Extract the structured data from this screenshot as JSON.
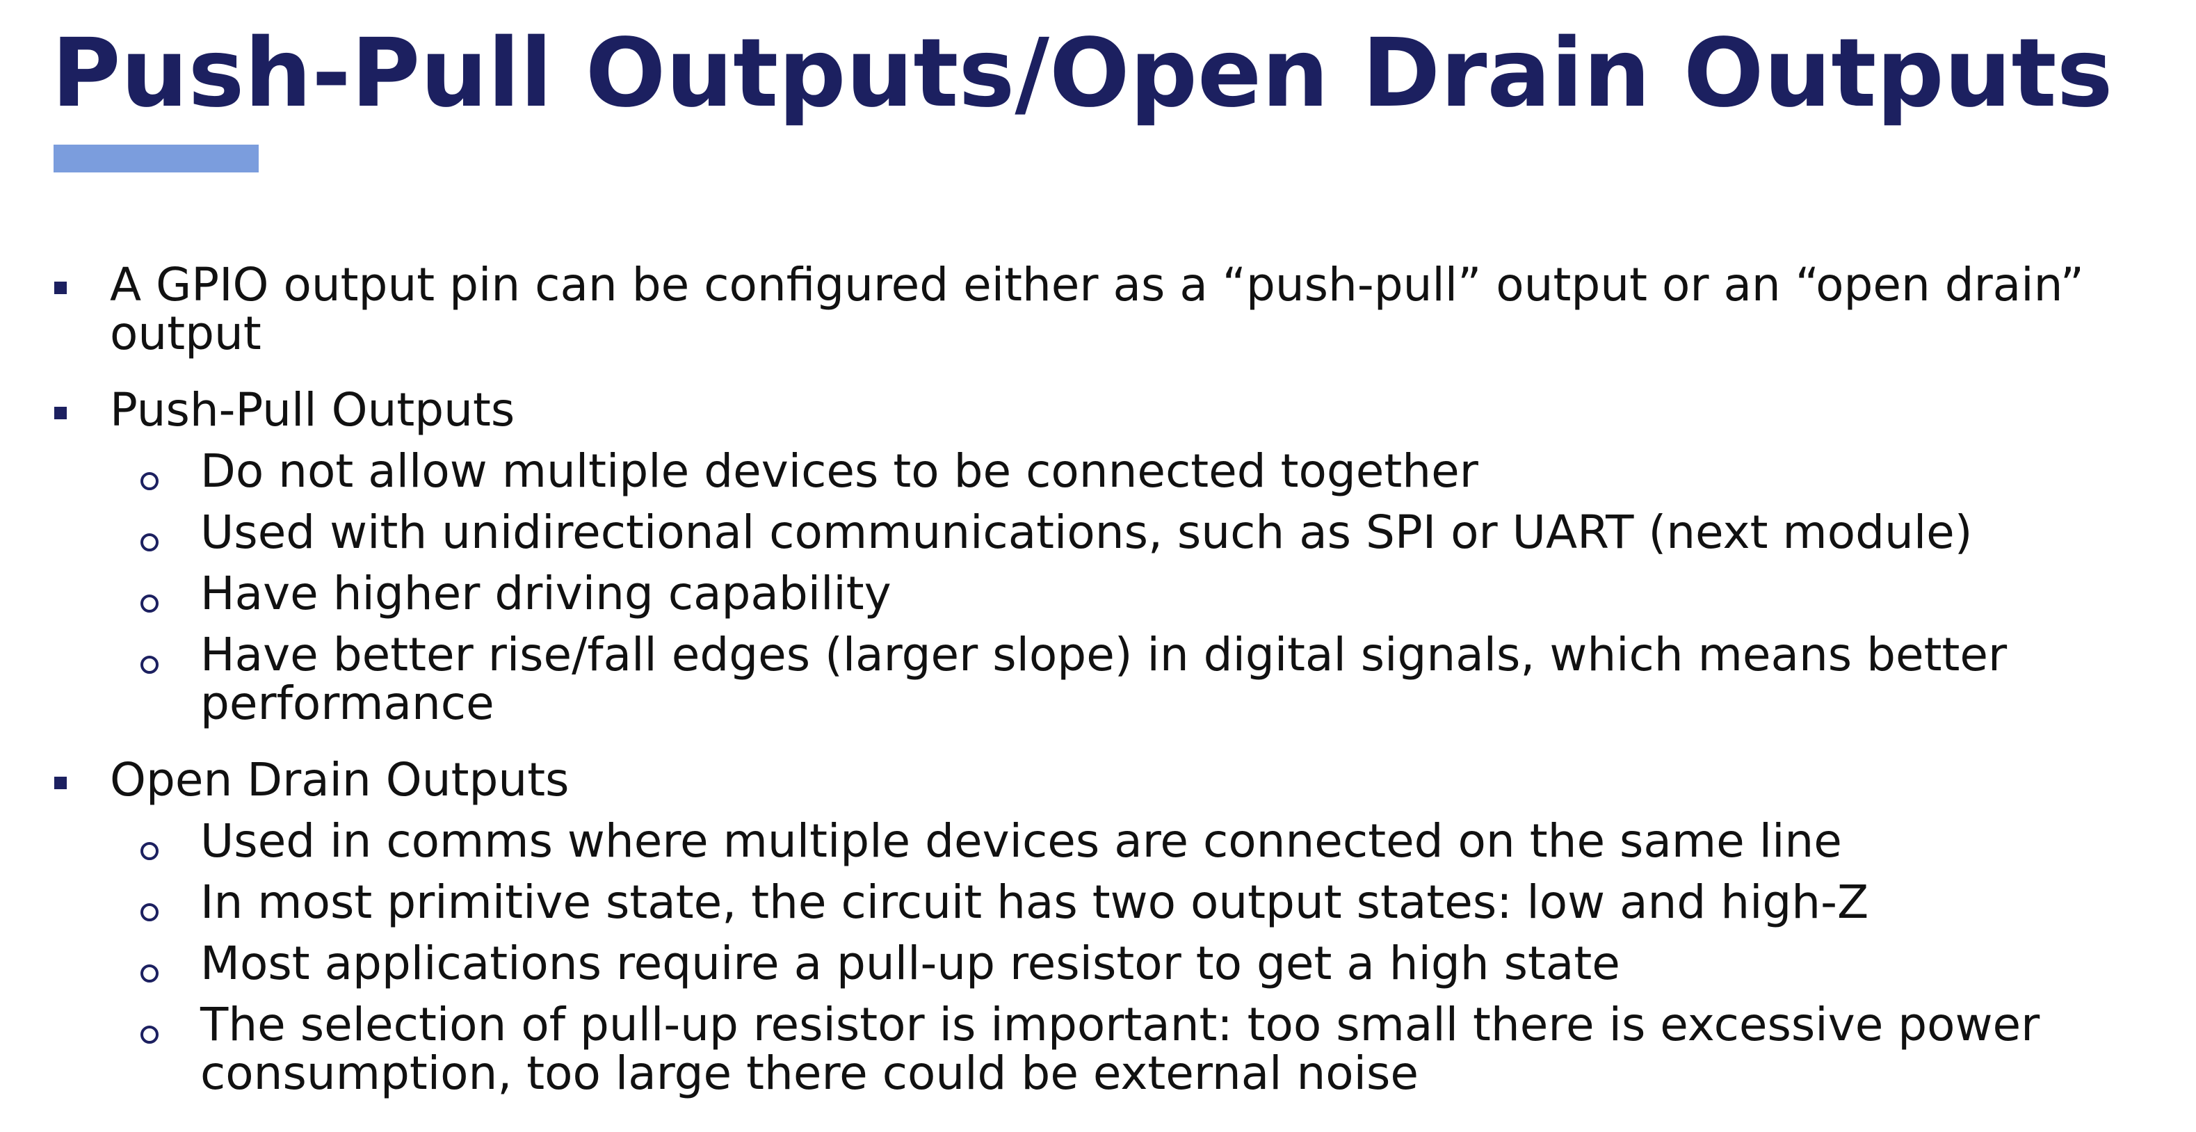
{
  "slide": {
    "title": "Push-Pull Outputs/Open Drain Outputs",
    "colors": {
      "title": "#1c2060",
      "accent_bar": "#7b9ddd",
      "text": "#111111",
      "bullet": "#1c2060"
    },
    "bullets": [
      {
        "text": "A GPIO output pin can be configured either as a “push-pull” output or an “open drain” output",
        "sub": []
      },
      {
        "text": "Push-Pull Outputs",
        "sub": [
          "Do not allow multiple devices to be connected together",
          "Used with unidirectional communications, such as SPI or UART (next module)",
          "Have higher driving capability",
          "Have better rise/fall edges (larger slope) in digital signals, which means better performance"
        ]
      },
      {
        "text": "Open Drain Outputs",
        "sub": [
          "Used in comms where multiple devices are connected on the same line",
          "In most primitive state, the circuit has two output states:  low and high-Z",
          "Most applications require a pull-up resistor to get a high state",
          "The selection of pull-up resistor is important:  too small there is excessive power consumption, too large there could be external noise"
        ]
      }
    ]
  }
}
